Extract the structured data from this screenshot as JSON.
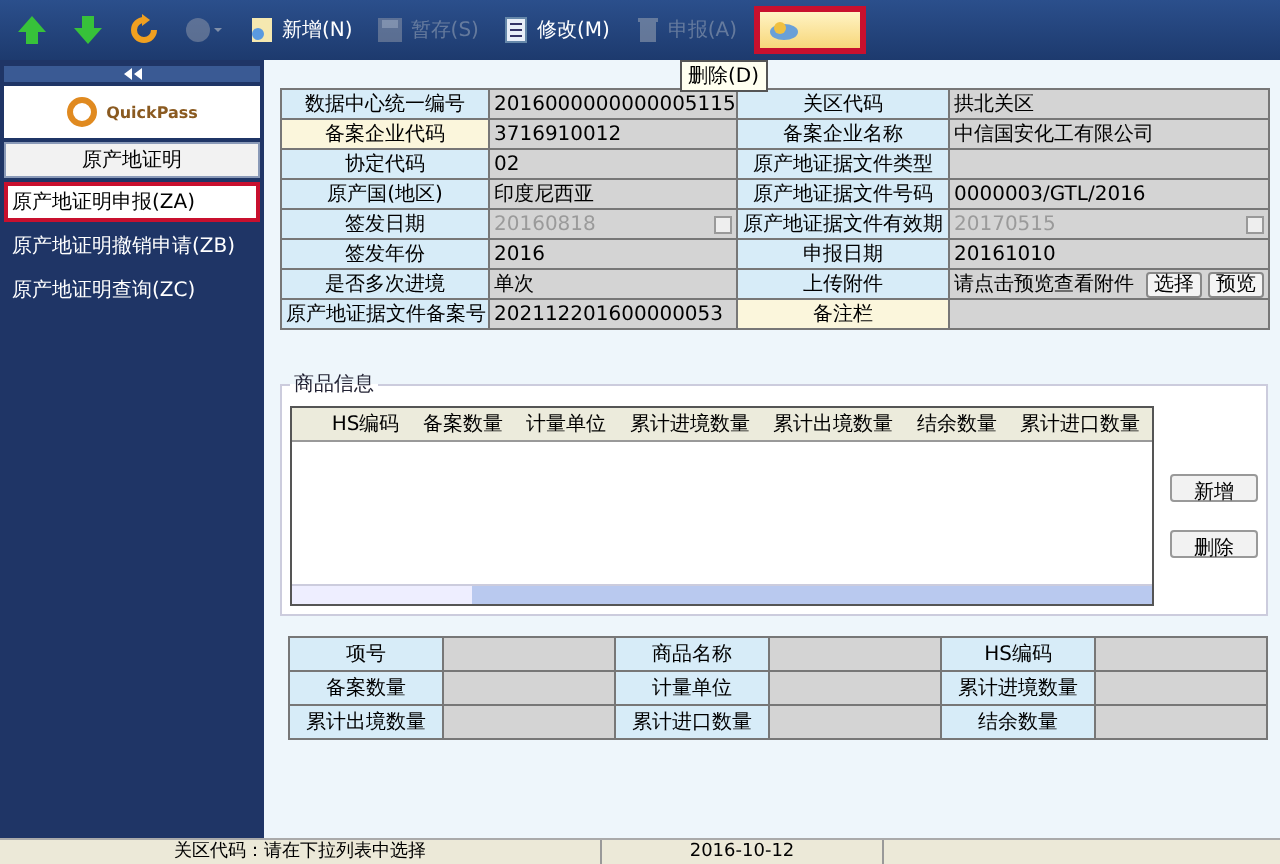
{
  "toolbar": {
    "items": [
      {
        "kind": "up",
        "disabled": false,
        "highlighted": false
      },
      {
        "kind": "down",
        "disabled": false,
        "highlighted": false
      },
      {
        "kind": "refresh",
        "disabled": false,
        "highlighted": false
      },
      {
        "kind": "circle",
        "disabled": true,
        "highlighted": false
      },
      {
        "kind": "new",
        "label": "新增(N)",
        "disabled": false,
        "highlighted": false
      },
      {
        "kind": "save",
        "label": "暂存(S)",
        "disabled": true,
        "highlighted": false
      },
      {
        "kind": "edit",
        "label": "修改(M)",
        "disabled": false,
        "highlighted": false
      },
      {
        "kind": "submit",
        "label": "申报(A)",
        "disabled": true,
        "highlighted": false
      },
      {
        "kind": "delete",
        "disabled": false,
        "highlighted": true
      }
    ],
    "tooltip": "删除(D)"
  },
  "sidebar": {
    "logo_text": "QuickPass",
    "section": "原产地证明",
    "items": [
      {
        "label": "原产地证明申报(ZA)",
        "selected": true
      },
      {
        "label": "原产地证明撤销申请(ZB)",
        "selected": false
      },
      {
        "label": "原产地证明查询(ZC)",
        "selected": false
      }
    ]
  },
  "form": {
    "rows": [
      [
        {
          "label": "数据中心统一编号",
          "value": "2016000000000005115",
          "kind": "text",
          "highlight": false
        },
        {
          "label": "关区代码",
          "value": "拱北关区",
          "kind": "text",
          "highlight": false
        }
      ],
      [
        {
          "label": "备案企业代码",
          "value": "3716910012",
          "kind": "text",
          "highlight": true
        },
        {
          "label": "备案企业名称",
          "value": "中信国安化工有限公司",
          "kind": "text",
          "highlight": false
        }
      ],
      [
        {
          "label": "协定代码",
          "value": "02",
          "kind": "text",
          "highlight": false
        },
        {
          "label": "原产地证据文件类型",
          "kind": "text",
          "highlight": false
        }
      ],
      [
        {
          "label": "原产国(地区)",
          "value": "印度尼西亚",
          "kind": "text",
          "highlight": false
        },
        {
          "label": "原产地证据文件号码",
          "value": "0000003/GTL/2016",
          "kind": "text",
          "highlight": false
        }
      ],
      [
        {
          "label": "签发日期",
          "value": "20160818",
          "kind": "date",
          "disabled": true,
          "highlight": false
        },
        {
          "label": "原产地证据文件有效期",
          "value": "20170515",
          "kind": "date",
          "disabled": true,
          "highlight": false
        }
      ],
      [
        {
          "label": "签发年份",
          "value": "2016",
          "kind": "text",
          "highlight": false
        },
        {
          "label": "申报日期",
          "value": "20161010",
          "kind": "text",
          "highlight": false
        }
      ],
      [
        {
          "label": "是否多次进境",
          "value": "单次",
          "kind": "text",
          "highlight": false
        },
        {
          "label": "上传附件",
          "value": "请点击预览查看附件",
          "kind": "attach",
          "highlight": false,
          "buttons": [
            "选择",
            "预览"
          ]
        }
      ],
      [
        {
          "label": "原产地证据文件备案号",
          "value": "202112201600000053",
          "kind": "text",
          "highlight": false
        },
        {
          "label": "备注栏",
          "kind": "text",
          "highlight": true
        }
      ]
    ]
  },
  "goods": {
    "title": "商品信息",
    "columns": [
      "HS编码",
      "备案数量",
      "计量单位",
      "累计进境数量",
      "累计出境数量",
      "结余数量",
      "累计进口数量"
    ],
    "buttons": [
      "新增",
      "删除"
    ]
  },
  "detail": {
    "rows": [
      [
        "项号",
        "商品名称",
        "HS编码"
      ],
      [
        "备案数量",
        "计量单位",
        "累计进境数量"
      ],
      [
        "累计出境数量",
        "累计进口数量",
        "结余数量"
      ]
    ]
  },
  "status_bar": [
    "关区代码：请在下拉列表中选择",
    "2016-10-12"
  ]
}
